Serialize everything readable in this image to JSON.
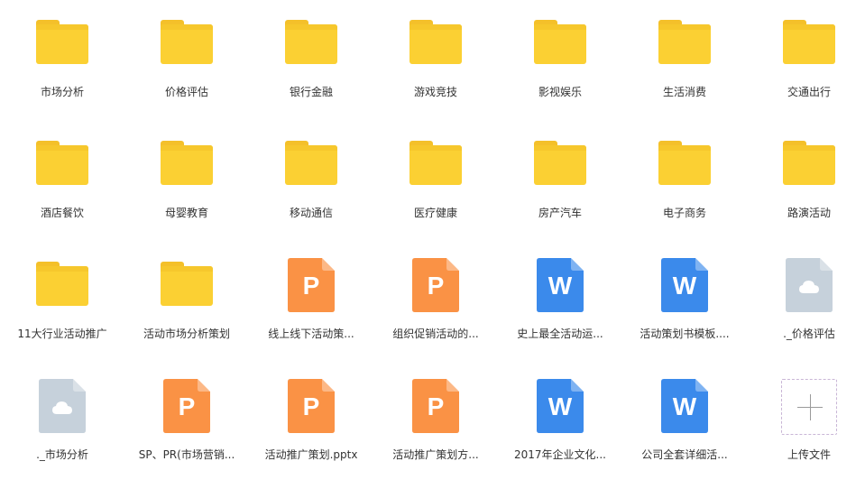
{
  "colors": {
    "folder": "#fbd033",
    "ppt": "#fa9245",
    "word": "#3b8aeb",
    "cloud": "#c6d1db",
    "label": "#333333"
  },
  "rows": [
    [
      {
        "type": "folder",
        "label": "市场分析"
      },
      {
        "type": "folder",
        "label": "价格评估"
      },
      {
        "type": "folder",
        "label": "银行金融"
      },
      {
        "type": "folder",
        "label": "游戏竞技"
      },
      {
        "type": "folder",
        "label": "影视娱乐"
      },
      {
        "type": "folder",
        "label": "生活消费"
      },
      {
        "type": "folder",
        "label": "交通出行"
      }
    ],
    [
      {
        "type": "folder",
        "label": "酒店餐饮"
      },
      {
        "type": "folder",
        "label": "母婴教育"
      },
      {
        "type": "folder",
        "label": "移动通信"
      },
      {
        "type": "folder",
        "label": "医疗健康"
      },
      {
        "type": "folder",
        "label": "房产汽车"
      },
      {
        "type": "folder",
        "label": "电子商务"
      },
      {
        "type": "folder",
        "label": "路演活动"
      }
    ],
    [
      {
        "type": "folder",
        "label": "11大行业活动推广"
      },
      {
        "type": "folder",
        "label": "活动市场分析策划"
      },
      {
        "type": "ppt",
        "label": "线上线下活动策...",
        "glyph": "P"
      },
      {
        "type": "ppt",
        "label": "组织促销活动的...",
        "glyph": "P"
      },
      {
        "type": "word",
        "label": "史上最全活动运...",
        "glyph": "W"
      },
      {
        "type": "word",
        "label": "活动策划书模板....",
        "glyph": "W"
      },
      {
        "type": "cloud",
        "label": "._价格评估"
      }
    ],
    [
      {
        "type": "cloud",
        "label": "._市场分析"
      },
      {
        "type": "ppt",
        "label": "SP、PR(市场营销...",
        "glyph": "P"
      },
      {
        "type": "ppt",
        "label": "活动推广策划.pptx",
        "glyph": "P"
      },
      {
        "type": "ppt",
        "label": "活动推广策划方...",
        "glyph": "P"
      },
      {
        "type": "word",
        "label": "2017年企业文化...",
        "glyph": "W"
      },
      {
        "type": "word",
        "label": "公司全套详细活...",
        "glyph": "W"
      },
      {
        "type": "upload",
        "label": "上传文件"
      }
    ]
  ]
}
